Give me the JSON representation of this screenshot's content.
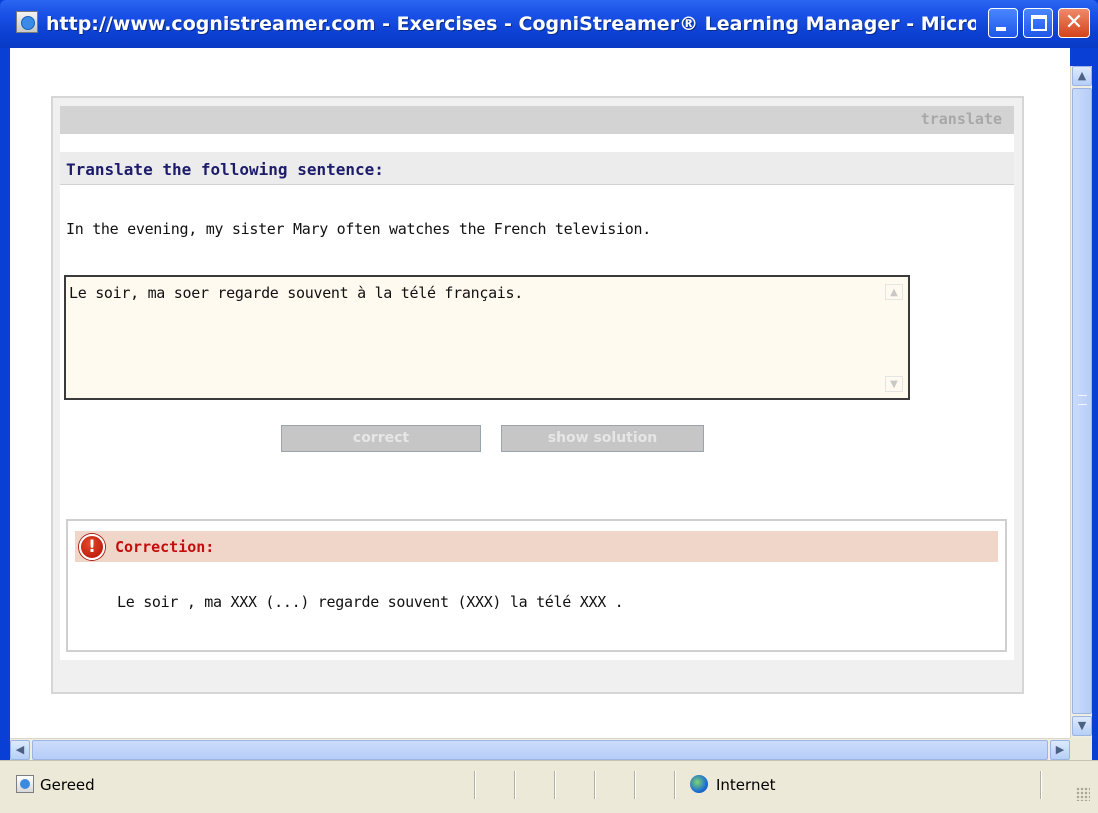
{
  "window": {
    "title": "http://www.cognistreamer.com - Exercises - CogniStreamer® Learning Manager - Micro...",
    "controls": {
      "minimize_icon": "minimize-icon",
      "maximize_icon": "maximize-icon",
      "close_icon": "close-icon",
      "close_glyph": "✕"
    }
  },
  "exercise": {
    "type_label": "translate",
    "heading": "Translate the following sentence:",
    "sentence": "In the evening, my sister Mary often watches the French television.",
    "answer_value": "Le soir, ma soer regarde souvent à la télé français.",
    "buttons": {
      "correct": "correct",
      "show_solution": "show solution"
    }
  },
  "correction": {
    "icon_glyph": "!",
    "title": "Correction:",
    "text": "Le soir , ma XXX (...) regarde souvent (XXX) la télé XXX ."
  },
  "scrollbars": {
    "up_glyph": "▲",
    "down_glyph": "▼",
    "left_glyph": "◀",
    "right_glyph": "▶"
  },
  "statusbar": {
    "status_text": "Gereed",
    "zone_text": "Internet"
  },
  "colors": {
    "titlebar": "#0c40d2",
    "heading": "#1c1c6b",
    "correction_title": "#c60d0d",
    "correction_band": "#efd6c9",
    "answer_bg": "#fffaf0"
  }
}
